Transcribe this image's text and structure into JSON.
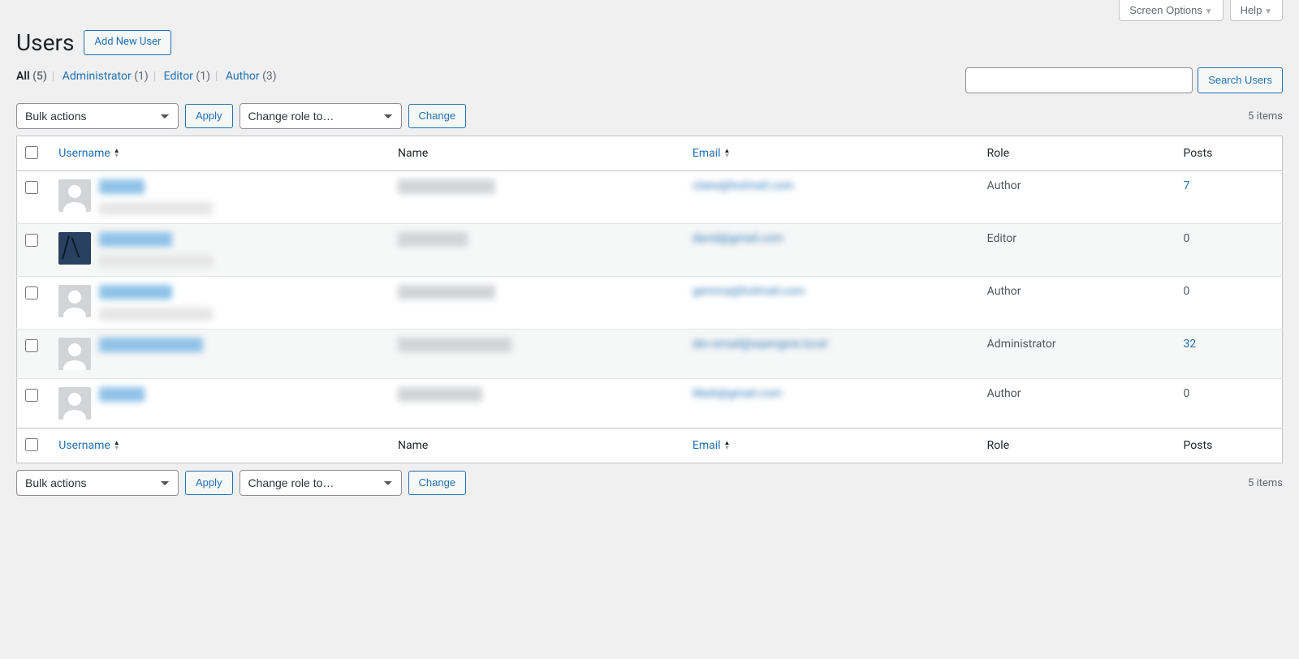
{
  "screen_meta": {
    "screen_options": "Screen Options",
    "help": "Help"
  },
  "header": {
    "title": "Users",
    "add_new": "Add New User"
  },
  "filters": {
    "all_label": "All",
    "all_count": "(5)",
    "admin_label": "Administrator",
    "admin_count": "(1)",
    "editor_label": "Editor",
    "editor_count": "(1)",
    "author_label": "Author",
    "author_count": "(3)"
  },
  "search": {
    "button": "Search Users"
  },
  "bulk": {
    "actions_label": "Bulk actions",
    "apply_label": "Apply",
    "role_label": "Change role to…",
    "change_label": "Change"
  },
  "count": "5 items",
  "columns": {
    "username": "Username",
    "name": "Name",
    "email": "Email",
    "role": "Role",
    "posts": "Posts"
  },
  "rows": [
    {
      "avatar": "default",
      "email": "claire@hotmail.com",
      "role": "Author",
      "posts": "7",
      "posts_link": true,
      "uw": 56,
      "nw": 120
    },
    {
      "avatar": "custom",
      "email": "david@gmail.com",
      "role": "Editor",
      "posts": "0",
      "posts_link": false,
      "uw": 90,
      "nw": 86
    },
    {
      "avatar": "default",
      "email": "gemma@hotmail.com",
      "role": "Author",
      "posts": "0",
      "posts_link": false,
      "uw": 90,
      "nw": 120
    },
    {
      "avatar": "default",
      "email": "dev-email@wpengine.local",
      "role": "Administrator",
      "posts": "32",
      "posts_link": true,
      "uw": 128,
      "nw": 140
    },
    {
      "avatar": "default",
      "email": "Mark@gmail.com",
      "role": "Author",
      "posts": "0",
      "posts_link": false,
      "uw": 56,
      "nw": 104
    }
  ]
}
